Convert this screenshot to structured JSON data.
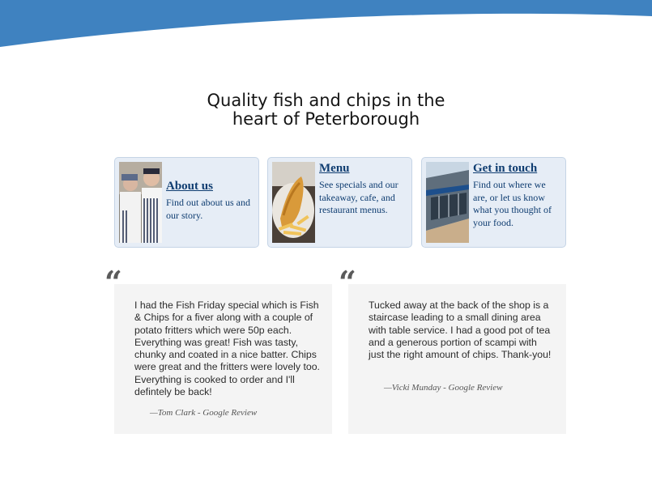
{
  "colors": {
    "wave": "#3f82c0",
    "card_bg": "#e6edf6",
    "link": "#0f3d71",
    "quote_bg": "#f4f4f4"
  },
  "headline": {
    "line1": "Quality fish and chips in the",
    "line2": "heart of Peterborough"
  },
  "cards": [
    {
      "title": "About us",
      "desc": "Find out about us and our story.",
      "image": "staff-photo"
    },
    {
      "title": "Menu",
      "desc": "See specials and our takeaway, cafe, and restaurant menus.",
      "image": "fish-and-chips-photo"
    },
    {
      "title": "Get in touch",
      "desc": "Find out where we are, or let us know what you thought of your food.",
      "image": "shopfront-photo"
    }
  ],
  "reviews": [
    {
      "text": "I had the Fish Friday special which is Fish & Chips for a fiver along with a couple of potato fritters which were 50p each. Everything was great! Fish was tasty, chunky and coated in a nice batter. Chips were great and the fritters were lovely too. Everything is cooked to order and I'll defintely be back!",
      "cite": "—Tom Clark - Google Review"
    },
    {
      "text": "Tucked away at the back of the shop is a staircase leading to a small dining area with table service. I had a good pot of tea and a generous portion of scampi with just the right amount of chips. Thank-you!",
      "cite": "—Vicki Munday - Google Review"
    }
  ],
  "quote_mark": "“"
}
